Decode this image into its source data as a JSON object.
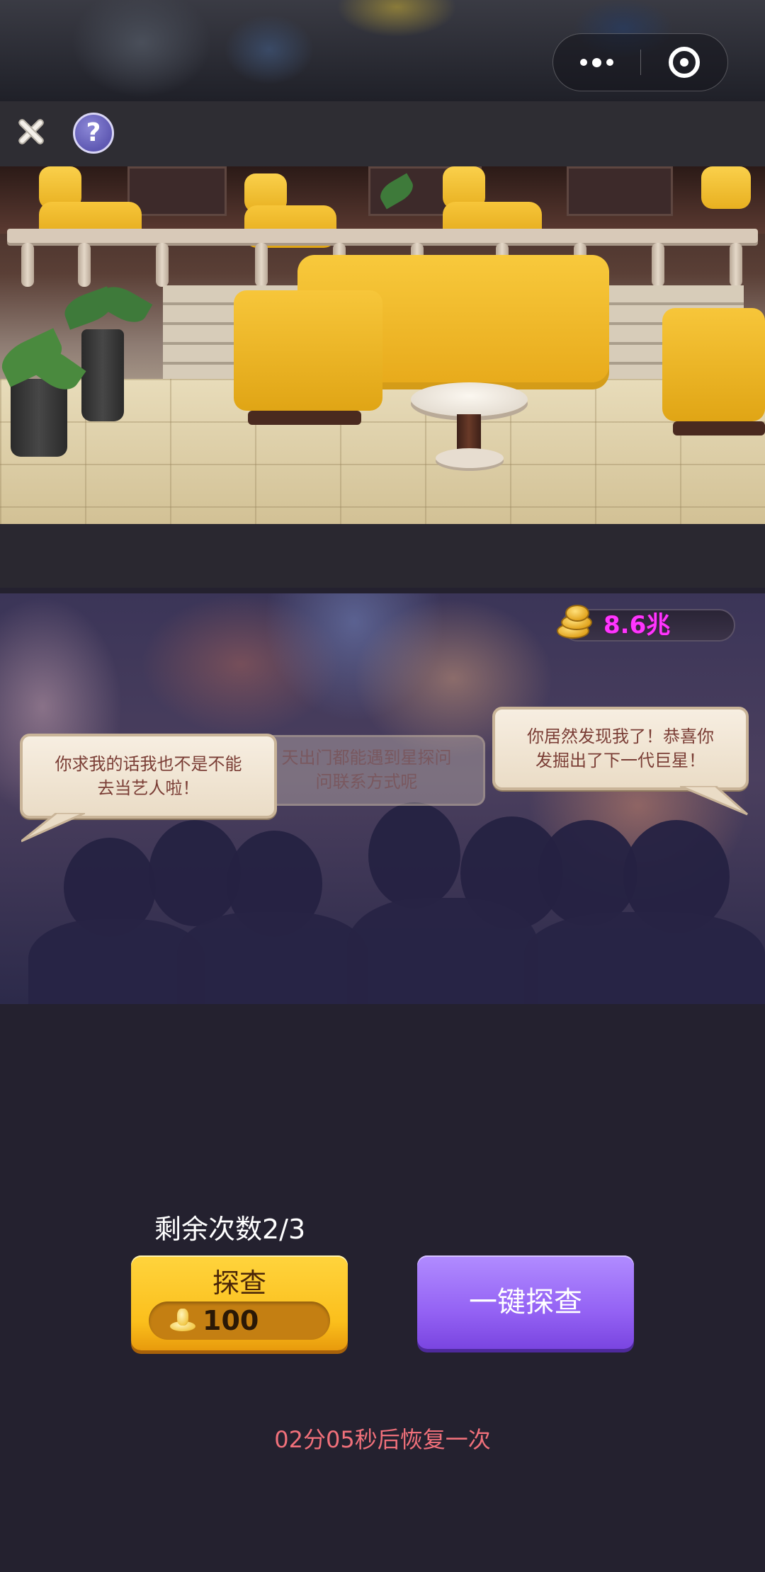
{
  "top_capsule": {
    "more_icon": "more-dots-icon",
    "close_icon": "mini-program-close-icon"
  },
  "toolbar": {
    "close_icon": "close-x-icon",
    "help_label": "?"
  },
  "scene": {
    "name": "lobby-scene"
  },
  "currency": {
    "icon": "gold-coins-icon",
    "value": "8.6兆",
    "color": "#ff35ff"
  },
  "bubbles": {
    "left": {
      "line1": "你求我的话我也不是不能",
      "line2": "去当艺人啦！"
    },
    "middle": {
      "line1": "天出门都能遇到星探问",
      "line2": "问联系方式呢"
    },
    "right": {
      "line1": "你居然发现我了！恭喜你",
      "line2": "发掘出了下一代巨星！"
    }
  },
  "controls": {
    "remaining_label": "剩余次数2/3",
    "investigate_label": "探查",
    "investigate_cost": "100",
    "investigate_cost_icon": "shoe-coin-icon",
    "auto_label": "一键探查",
    "recover_text": "02分05秒后恢复一次"
  },
  "colors": {
    "background": "#24212f",
    "investigate_button": "#fbbf1c",
    "auto_button": "#9462f4",
    "recover_text": "#f0707a"
  }
}
